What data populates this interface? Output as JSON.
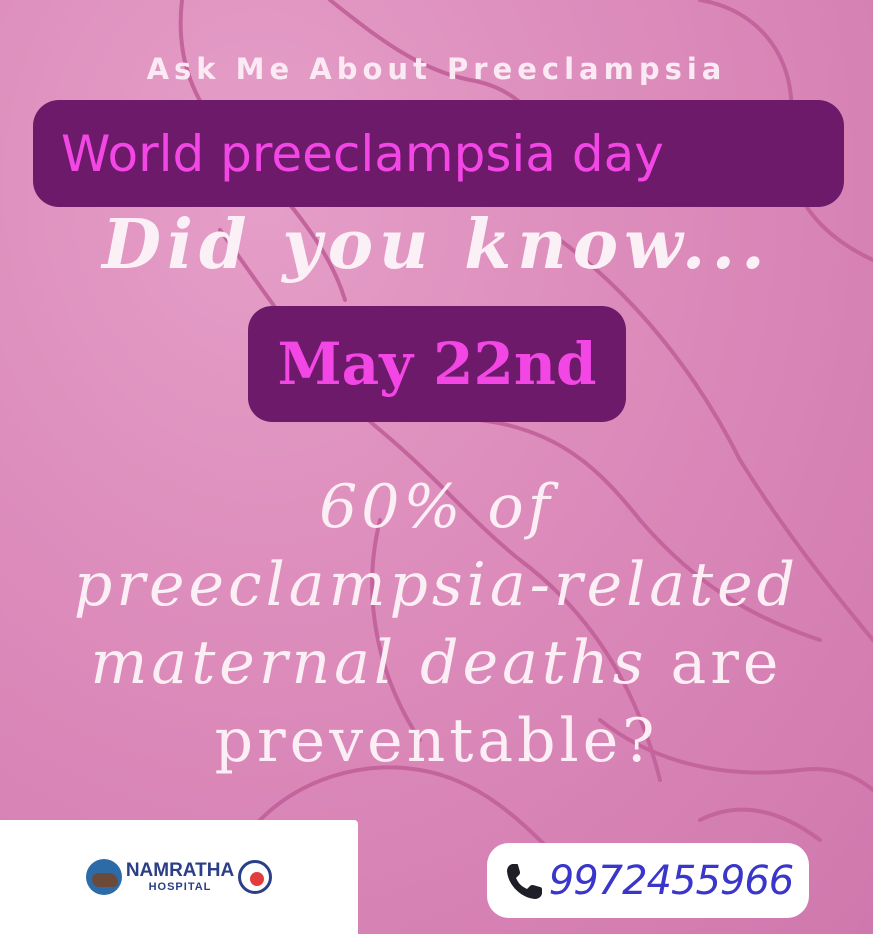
{
  "header": {
    "tagline": "Ask Me About Preeclampsia"
  },
  "banner": {
    "title": "World preeclampsia day"
  },
  "intro": {
    "question": "Did you know..."
  },
  "date": {
    "label": "May 22nd"
  },
  "fact": {
    "line1": "60% of",
    "line2": "preeclampsia-related",
    "line3_italic": "maternal deaths",
    "line3_rest": " are",
    "line4": "preventable?"
  },
  "logo": {
    "name": "NAMRATHA",
    "subtitle": "HOSPITAL"
  },
  "contact": {
    "phone": "9972455966",
    "icon": "phone-icon"
  },
  "colors": {
    "background": "#de8fbd",
    "banner_bg": "#6e1a6a",
    "accent_text": "#f247e5",
    "phone_text": "#3a36c9",
    "logo_text": "#2a3f85"
  }
}
